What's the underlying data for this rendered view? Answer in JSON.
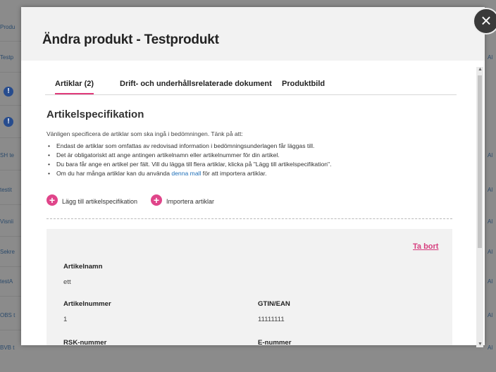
{
  "background": {
    "left_rows": [
      "Produ",
      "Testp",
      "!",
      "!",
      "SH te",
      "testit",
      "Visnii",
      "Sekre",
      "testA",
      "OBS t",
      "BVB t"
    ],
    "right_rows": [
      "Al",
      "Al",
      "Al",
      "Al",
      "Al",
      "Al",
      "Al",
      "Al"
    ]
  },
  "modal": {
    "title": "Ändra produkt - Testprodukt",
    "close_glyph": "×"
  },
  "tabs": [
    {
      "label": "Artiklar (2)",
      "active": true
    },
    {
      "label": "Drift- och underhållsrelaterade dokument",
      "active": false
    },
    {
      "label": "Produktbild",
      "active": false
    }
  ],
  "section": {
    "title": "Artikelspecifikation",
    "intro": "Vänligen specificera de artiklar som ska ingå i bedömningen. Tänk på att:",
    "bullets": [
      "Endast de artiklar som omfattas av redovisad information i bedömningsunderlagen får läggas till.",
      "Det är obligatoriskt att ange antingen artikelnamn eller artikelnummer för din artikel.",
      "Du bara får ange en artikel per fält. Vill du lägga till flera artiklar, klicka på \"Lägg till artikelspecifikation\"."
    ],
    "last_bullet_prefix": "Om du har många artiklar kan du använda ",
    "last_bullet_link": "denna mall",
    "last_bullet_suffix": " för att importera artiklar."
  },
  "actions": {
    "add_label": "Lägg till artikelspecifikation",
    "import_label": "Importera artiklar"
  },
  "article": {
    "remove_label": "Ta bort",
    "name_label": "Artikelnamn",
    "name_value": "ett",
    "number_label": "Artikelnummer",
    "number_value": "1",
    "gtin_label": "GTIN/EAN",
    "gtin_value": "11111111",
    "rsk_label": "RSK-nummer",
    "e_label": "E-nummer"
  },
  "colors": {
    "accent": "#e0458a",
    "link": "#1f6fb8"
  }
}
